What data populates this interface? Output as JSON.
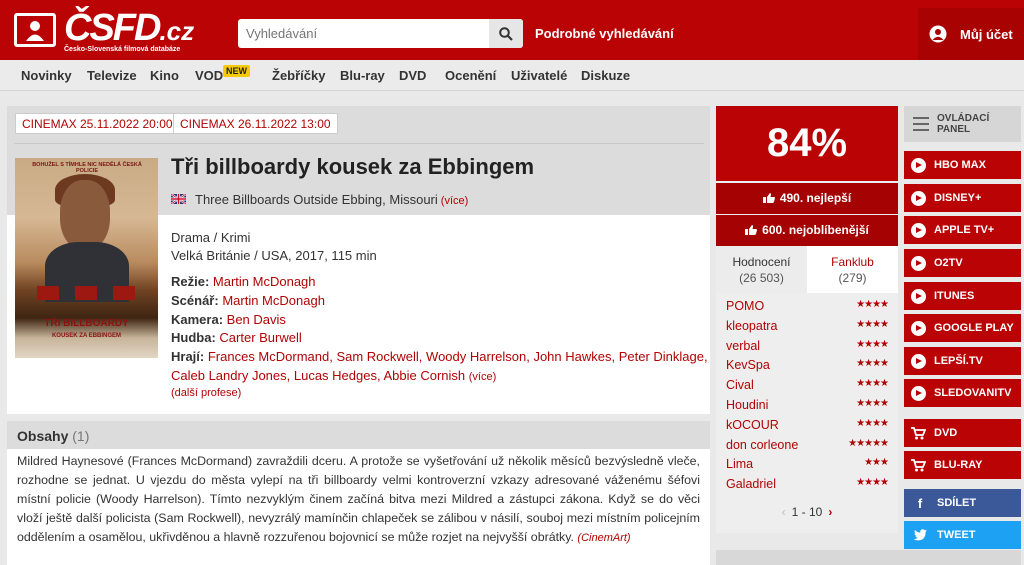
{
  "header": {
    "logo_text": "ČSFD",
    "logo_suffix": ".cz",
    "logo_sub": "Česko-Slovenská filmová databáze",
    "search_placeholder": "Vyhledávání",
    "advanced_search": "Podrobné vyhledávání",
    "account": "Můj účet"
  },
  "nav": {
    "items": [
      "Novinky",
      "Televize",
      "Kino",
      "VOD",
      "Žebříčky",
      "Blu-ray",
      "DVD",
      "Ocenění",
      "Uživatelé",
      "Diskuze"
    ],
    "badge": "NEW"
  },
  "cinema": [
    "CINEMAX 25.11.2022 20:00",
    "CINEMAX 26.11.2022 13:00"
  ],
  "film": {
    "title": "Tři billboardy kousek za Ebbingem",
    "original_title": "Three Billboards Outside Ebbing, Missouri",
    "more": "(více)",
    "genre": "Drama / Krimi",
    "origin": "Velká Británie / USA, 2017, 115 min",
    "directing_label": "Režie:",
    "directing": "Martin McDonagh",
    "screenplay_label": "Scénář:",
    "screenplay": "Martin McDonagh",
    "camera_label": "Kamera:",
    "camera": "Ben Davis",
    "music_label": "Hudba:",
    "music": "Carter Burwell",
    "cast_label": "Hrají:",
    "cast_line1": "Frances McDormand, Sam Rockwell, Woody Harrelson, John Hawkes, Peter Dinklage,",
    "cast_line2": "Caleb Landry Jones, Lucas Hedges, Abbie Cornish",
    "cast_more": "(více)",
    "other_professions": "(další profese)",
    "poster": {
      "top_text": "BOHUŽEL S TÍMHLE NIC NEDĚLÁ ČESKÁ POLICIE",
      "title_line1": "TŘI BILLBOARDY",
      "title_line2": "KOUSEK ZA EBBINGEM"
    }
  },
  "plot": {
    "heading": "Obsahy",
    "count": "(1)",
    "text": "Mildred Haynesové (Frances McDormand) zavraždili dceru. A protože se vyšetřování už několik měsíců bezvýsledně vleče, rozhodne se jednat. U vjezdu do města vylepí na tři billboardy velmi kontroverzní vzkazy adresované váženému šéfovi místní policie (Woody Harrelson). Tímto nezvyklým činem začíná bitva mezi Mildred a zástupci zákona. Když se do věci vloží ještě další policista (Sam Rockwell), nevyzrálý mamínčin chlapeček se zálibou v násilí, souboj mezi místním policejním oddělením a osamělou, ukřivděnou a hlavně rozzuřenou bojovnicí se může rozjet na nejvyšší obrátky.",
    "source": "(CinemArt)"
  },
  "rating": {
    "percent": "84%",
    "best": "490. nejlepší",
    "favorite": "600. nejoblíbenější",
    "tab_ratings_label": "Hodnocení",
    "tab_ratings_count": "(26 503)",
    "tab_fanclub_label": "Fanklub",
    "tab_fanclub_count": "(279)",
    "users": [
      {
        "name": "POMO",
        "stars": 4
      },
      {
        "name": "kleopatra",
        "stars": 4
      },
      {
        "name": "verbal",
        "stars": 4
      },
      {
        "name": "KevSpa",
        "stars": 4
      },
      {
        "name": "Cival",
        "stars": 4
      },
      {
        "name": "Houdini",
        "stars": 4
      },
      {
        "name": "kOCOUR",
        "stars": 4
      },
      {
        "name": "don corleone",
        "stars": 5
      },
      {
        "name": "Lima",
        "stars": 3
      },
      {
        "name": "Galadriel",
        "stars": 4
      }
    ],
    "pager": "1 - 10"
  },
  "sidebar": {
    "control_panel": "OVLÁDACÍ PANEL",
    "services": [
      "HBO MAX",
      "DISNEY+",
      "APPLE TV+",
      "O2TV",
      "ITUNES",
      "GOOGLE PLAY",
      "LEPŠÍ.TV",
      "SLEDOVANITV"
    ],
    "shop": [
      "DVD",
      "BLU-RAY"
    ],
    "share": "SDÍLET",
    "tweet": "TWEET"
  },
  "colors": {
    "brand_red": "#ba0305",
    "dark_red": "#a40203",
    "facebook": "#3b5998",
    "twitter": "#1da1f2"
  }
}
